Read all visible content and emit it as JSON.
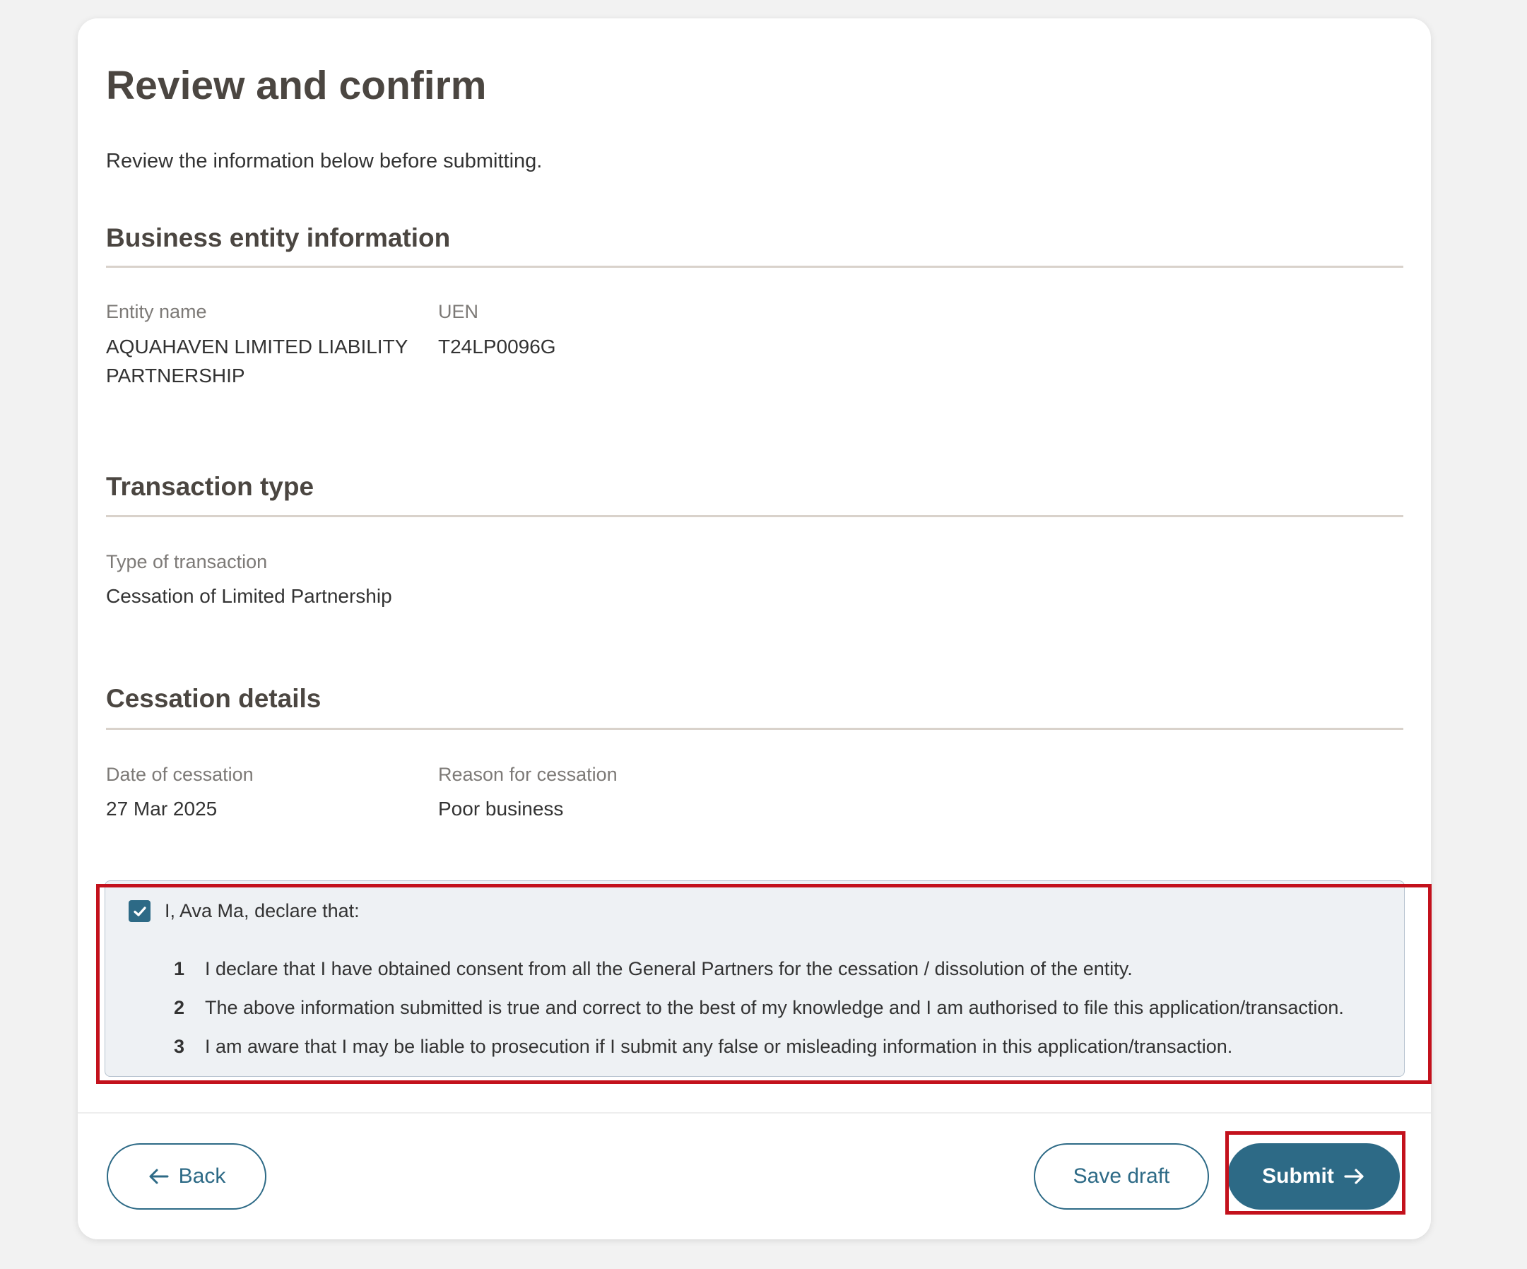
{
  "page": {
    "title": "Review and confirm",
    "subtitle": "Review the information below before submitting."
  },
  "business_entity": {
    "heading": "Business entity information",
    "entity_name_label": "Entity name",
    "entity_name_line1": "AQUAHAVEN LIMITED LIABILITY",
    "entity_name_line2": "PARTNERSHIP",
    "uen_label": "UEN",
    "uen_value": "T24LP0096G"
  },
  "transaction": {
    "heading": "Transaction type",
    "type_label": "Type of transaction",
    "type_value": "Cessation of Limited Partnership"
  },
  "cessation": {
    "heading": "Cessation details",
    "date_label": "Date of cessation",
    "date_value": "27 Mar 2025",
    "reason_label": "Reason for cessation",
    "reason_value": "Poor business"
  },
  "declaration": {
    "checked": true,
    "intro": "I, Ava Ma, declare that:",
    "items": [
      {
        "num": "1",
        "text": "I declare that I have obtained consent from all the General Partners for the cessation / dissolution of the entity."
      },
      {
        "num": "2",
        "text": "The above information submitted is true and correct to the best of my knowledge and I am authorised to file this application/transaction."
      },
      {
        "num": "3",
        "text": "I am aware that I may be liable to prosecution if I submit any false or misleading information in this application/transaction."
      }
    ]
  },
  "actions": {
    "back_label": "Back",
    "save_draft_label": "Save draft",
    "submit_label": "Submit"
  },
  "icons": {
    "back": "arrow-left-icon",
    "submit": "arrow-right-icon",
    "checkbox": "checkmark-icon"
  },
  "colors": {
    "primary": "#2d6a86",
    "heading": "#4b4641",
    "highlight": "#c3111c",
    "rule": "#d9d2cb"
  }
}
